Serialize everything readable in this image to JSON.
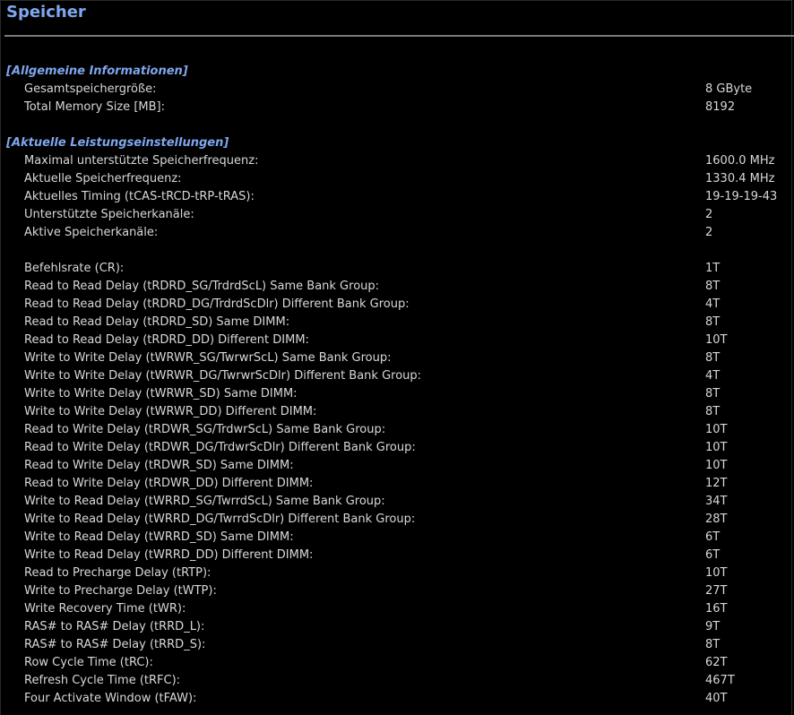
{
  "page": {
    "title": "Speicher"
  },
  "sections": [
    {
      "header": "[Allgemeine Informationen]",
      "rows": [
        {
          "label": "Gesamtspeichergröße:",
          "value": "8 GByte"
        },
        {
          "label": "Total Memory Size [MB]:",
          "value": "8192"
        }
      ]
    },
    {
      "header": "[Aktuelle Leistungseinstellungen]",
      "rows": [
        {
          "label": "Maximal unterstützte Speicherfrequenz:",
          "value": "1600.0 MHz"
        },
        {
          "label": "Aktuelle Speicherfrequenz:",
          "value": "1330.4 MHz"
        },
        {
          "label": "Aktuelles Timing (tCAS-tRCD-tRP-tRAS):",
          "value": "19-19-19-43"
        },
        {
          "label": "Unterstützte Speicherkanäle:",
          "value": "2"
        },
        {
          "label": "Aktive Speicherkanäle:",
          "value": "2"
        }
      ],
      "timings": [
        {
          "label": "Befehlsrate (CR):",
          "value": "1T"
        },
        {
          "label": "Read to Read Delay (tRDRD_SG/TrdrdScL) Same Bank Group:",
          "value": "8T"
        },
        {
          "label": "Read to Read Delay (tRDRD_DG/TrdrdScDlr) Different Bank Group:",
          "value": "4T"
        },
        {
          "label": "Read to Read Delay (tRDRD_SD) Same DIMM:",
          "value": "8T"
        },
        {
          "label": "Read to Read Delay (tRDRD_DD) Different DIMM:",
          "value": "10T"
        },
        {
          "label": "Write to Write Delay (tWRWR_SG/TwrwrScL) Same Bank Group:",
          "value": "8T"
        },
        {
          "label": "Write to Write Delay (tWRWR_DG/TwrwrScDlr) Different Bank Group:",
          "value": "4T"
        },
        {
          "label": "Write to Write Delay (tWRWR_SD) Same DIMM:",
          "value": "8T"
        },
        {
          "label": "Write to Write Delay (tWRWR_DD) Different DIMM:",
          "value": "8T"
        },
        {
          "label": "Read to Write Delay (tRDWR_SG/TrdwrScL) Same Bank Group:",
          "value": "10T"
        },
        {
          "label": "Read to Write Delay (tRDWR_DG/TrdwrScDlr) Different Bank Group:",
          "value": "10T"
        },
        {
          "label": "Read to Write Delay (tRDWR_SD) Same DIMM:",
          "value": "10T"
        },
        {
          "label": "Read to Write Delay (tRDWR_DD) Different DIMM:",
          "value": "12T"
        },
        {
          "label": "Write to Read Delay (tWRRD_SG/TwrrdScL) Same Bank Group:",
          "value": "34T"
        },
        {
          "label": "Write to Read Delay (tWRRD_DG/TwrrdScDlr) Different Bank Group:",
          "value": "28T"
        },
        {
          "label": "Write to Read Delay (tWRRD_SD) Same DIMM:",
          "value": "6T"
        },
        {
          "label": "Write to Read Delay (tWRRD_DD) Different DIMM:",
          "value": "6T"
        },
        {
          "label": "Read to Precharge Delay (tRTP):",
          "value": "10T"
        },
        {
          "label": "Write to Precharge Delay (tWTP):",
          "value": "27T"
        },
        {
          "label": "Write Recovery Time (tWR):",
          "value": "16T"
        },
        {
          "label": "RAS# to RAS# Delay (tRRD_L):",
          "value": "9T"
        },
        {
          "label": "RAS# to RAS# Delay (tRRD_S):",
          "value": "8T"
        },
        {
          "label": "Row Cycle Time (tRC):",
          "value": "62T"
        },
        {
          "label": "Refresh Cycle Time (tRFC):",
          "value": "467T"
        },
        {
          "label": "Four Activate Window (tFAW):",
          "value": "40T"
        }
      ]
    }
  ],
  "colors": {
    "background": "#000000",
    "text": "#d8d8d8",
    "accent": "#7fa6ee",
    "divider": "#7a7a7a"
  }
}
